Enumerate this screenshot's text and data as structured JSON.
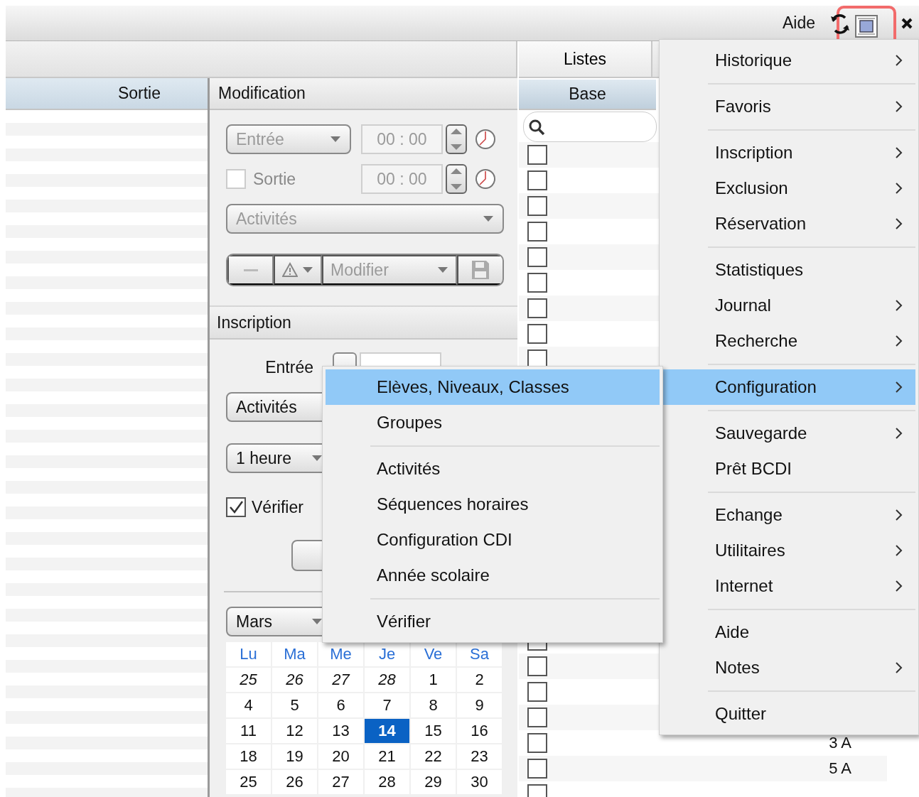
{
  "toolbar": {
    "help_label": "Aide",
    "layout_highlighted": true
  },
  "left_list": {
    "header": "Sortie"
  },
  "modification": {
    "title": "Modification",
    "disabled": true,
    "entry_type": "Entrée",
    "entry_time": "00 : 00",
    "exit_checked": false,
    "exit_label": "Sortie",
    "exit_time": "00 : 00",
    "activities": "Activités",
    "action": "Modifier"
  },
  "inscription": {
    "title": "Inscription",
    "entry_label": "Entrée",
    "activities": "Activités",
    "duration": "1 heure",
    "verify_checked": true,
    "verify_label": "Vérifier",
    "month": "Mars",
    "calendar": {
      "weekdays": [
        "Lu",
        "Ma",
        "Me",
        "Je",
        "Ve",
        "Sa"
      ],
      "weeks": [
        [
          {
            "day": "25",
            "other_month": true,
            "selected": false
          },
          {
            "day": "26",
            "other_month": true,
            "selected": false
          },
          {
            "day": "27",
            "other_month": true,
            "selected": false
          },
          {
            "day": "28",
            "other_month": true,
            "selected": false
          },
          {
            "day": "1",
            "other_month": false,
            "selected": false
          },
          {
            "day": "2",
            "other_month": false,
            "selected": false
          }
        ],
        [
          {
            "day": "4",
            "other_month": false,
            "selected": false
          },
          {
            "day": "5",
            "other_month": false,
            "selected": false
          },
          {
            "day": "6",
            "other_month": false,
            "selected": false
          },
          {
            "day": "7",
            "other_month": false,
            "selected": false
          },
          {
            "day": "8",
            "other_month": false,
            "selected": false
          },
          {
            "day": "9",
            "other_month": false,
            "selected": false
          }
        ],
        [
          {
            "day": "11",
            "other_month": false,
            "selected": false
          },
          {
            "day": "12",
            "other_month": false,
            "selected": false
          },
          {
            "day": "13",
            "other_month": false,
            "selected": false
          },
          {
            "day": "14",
            "other_month": false,
            "selected": true
          },
          {
            "day": "15",
            "other_month": false,
            "selected": false
          },
          {
            "day": "16",
            "other_month": false,
            "selected": false
          }
        ],
        [
          {
            "day": "18",
            "other_month": false,
            "selected": false
          },
          {
            "day": "19",
            "other_month": false,
            "selected": false
          },
          {
            "day": "20",
            "other_month": false,
            "selected": false
          },
          {
            "day": "21",
            "other_month": false,
            "selected": false
          },
          {
            "day": "22",
            "other_month": false,
            "selected": false
          },
          {
            "day": "23",
            "other_month": false,
            "selected": false
          }
        ],
        [
          {
            "day": "25",
            "other_month": false,
            "selected": false
          },
          {
            "day": "26",
            "other_month": false,
            "selected": false
          },
          {
            "day": "27",
            "other_month": false,
            "selected": false
          },
          {
            "day": "28",
            "other_month": false,
            "selected": false
          },
          {
            "day": "29",
            "other_month": false,
            "selected": false
          },
          {
            "day": "30",
            "other_month": false,
            "selected": false
          }
        ]
      ]
    }
  },
  "right_list": {
    "tab": "Listes",
    "header": "Base",
    "rows": [
      {
        "checked": false
      },
      {
        "checked": false
      },
      {
        "checked": false
      },
      {
        "checked": false
      },
      {
        "checked": false
      },
      {
        "checked": false
      },
      {
        "checked": false
      },
      {
        "checked": false
      },
      {
        "checked": false
      },
      {
        "checked": false
      },
      {
        "checked": false
      },
      {
        "checked": false
      },
      {
        "checked": false
      },
      {
        "checked": false,
        "class": "3 A"
      },
      {
        "checked": false,
        "class": "5 A"
      },
      {
        "checked": false
      }
    ]
  },
  "main_menu": [
    {
      "kind": "item",
      "label": "Historique",
      "submenu": true,
      "selected": false
    },
    {
      "kind": "separator"
    },
    {
      "kind": "item",
      "label": "Favoris",
      "submenu": true,
      "selected": false
    },
    {
      "kind": "separator"
    },
    {
      "kind": "item",
      "label": "Inscription",
      "submenu": true,
      "selected": false
    },
    {
      "kind": "item",
      "label": "Exclusion",
      "submenu": true,
      "selected": false
    },
    {
      "kind": "item",
      "label": "Réservation",
      "submenu": true,
      "selected": false
    },
    {
      "kind": "separator"
    },
    {
      "kind": "item",
      "label": "Statistiques",
      "submenu": false,
      "selected": false
    },
    {
      "kind": "item",
      "label": "Journal",
      "submenu": true,
      "selected": false
    },
    {
      "kind": "item",
      "label": "Recherche",
      "submenu": true,
      "selected": false
    },
    {
      "kind": "separator"
    },
    {
      "kind": "item",
      "label": "Configuration",
      "submenu": true,
      "selected": true
    },
    {
      "kind": "separator"
    },
    {
      "kind": "item",
      "label": "Sauvegarde",
      "submenu": true,
      "selected": false
    },
    {
      "kind": "item",
      "label": "Prêt BCDI",
      "submenu": false,
      "selected": false
    },
    {
      "kind": "separator"
    },
    {
      "kind": "item",
      "label": "Echange",
      "submenu": true,
      "selected": false
    },
    {
      "kind": "item",
      "label": "Utilitaires",
      "submenu": true,
      "selected": false
    },
    {
      "kind": "item",
      "label": "Internet",
      "submenu": true,
      "selected": false
    },
    {
      "kind": "separator"
    },
    {
      "kind": "item",
      "label": "Aide",
      "submenu": false,
      "selected": false
    },
    {
      "kind": "item",
      "label": "Notes",
      "submenu": true,
      "selected": false
    },
    {
      "kind": "separator"
    },
    {
      "kind": "item",
      "label": "Quitter",
      "submenu": false,
      "selected": false
    }
  ],
  "submenu": [
    {
      "kind": "item",
      "label": "Elèves, Niveaux, Classes",
      "submenu": false,
      "selected": true
    },
    {
      "kind": "item",
      "label": "Groupes",
      "submenu": false,
      "selected": false
    },
    {
      "kind": "separator"
    },
    {
      "kind": "item",
      "label": "Activités",
      "submenu": false,
      "selected": false
    },
    {
      "kind": "item",
      "label": "Séquences horaires",
      "submenu": false,
      "selected": false
    },
    {
      "kind": "item",
      "label": "Configuration CDI",
      "submenu": false,
      "selected": false
    },
    {
      "kind": "item",
      "label": "Année scolaire",
      "submenu": false,
      "selected": false
    },
    {
      "kind": "separator"
    },
    {
      "kind": "item",
      "label": "Vérifier",
      "submenu": false,
      "selected": false
    }
  ]
}
